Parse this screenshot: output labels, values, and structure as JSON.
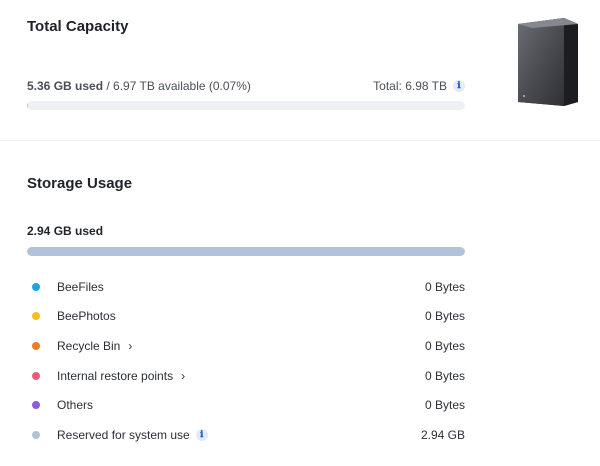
{
  "capacity": {
    "title": "Total Capacity",
    "used": "5.36 GB used",
    "available": " / 6.97 TB available (0.07%)",
    "total": "Total: 6.98 TB",
    "used_fraction": 0.0007,
    "bar_color": "#b8c6db"
  },
  "usage": {
    "title": "Storage Usage",
    "used": "2.94 GB used",
    "used_fraction": 1.0,
    "bar_color": "#b2c2da",
    "items": [
      {
        "label": "BeeFiles",
        "value": "0 Bytes",
        "color": "#1aa3e8",
        "chevron": false,
        "info": false
      },
      {
        "label": "BeePhotos",
        "value": "0 Bytes",
        "color": "#f5c01e",
        "chevron": false,
        "info": false
      },
      {
        "label": "Recycle Bin",
        "value": "0 Bytes",
        "color": "#f07c22",
        "chevron": true,
        "info": false
      },
      {
        "label": "Internal restore points",
        "value": "0 Bytes",
        "color": "#ea5d77",
        "chevron": true,
        "info": false
      },
      {
        "label": "Others",
        "value": "0 Bytes",
        "color": "#8a5ce0",
        "chevron": false,
        "info": false
      },
      {
        "label": "Reserved for system use",
        "value": "2.94 GB",
        "color": "#b2c2da",
        "chevron": false,
        "info": true
      }
    ]
  },
  "icons": {
    "info": "ℹ",
    "chevron": "›"
  }
}
